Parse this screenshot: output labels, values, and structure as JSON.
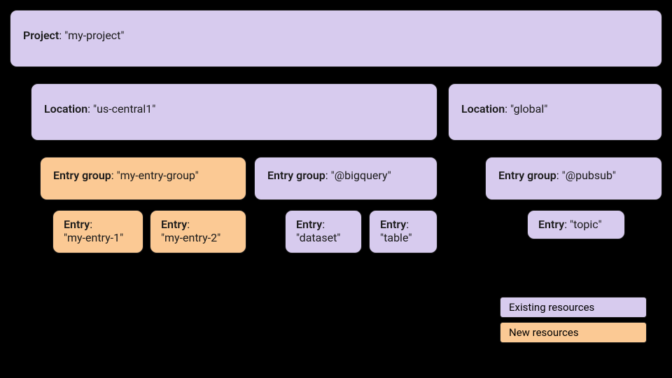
{
  "project": {
    "label": "Project",
    "value": "\"my-project\""
  },
  "locations": [
    {
      "label": "Location",
      "value": "\"us-central1\""
    },
    {
      "label": "Location",
      "value": "\"global\""
    }
  ],
  "entry_groups": [
    {
      "label": "Entry group",
      "value": "\"my-entry-group\"",
      "status": "new"
    },
    {
      "label": "Entry group",
      "value": "\"@bigquery\"",
      "status": "existing"
    },
    {
      "label": "Entry group",
      "value": "\"@pubsub\"",
      "status": "existing"
    }
  ],
  "entries": [
    {
      "label": "Entry",
      "value": "\"my-entry-1\"",
      "status": "new"
    },
    {
      "label": "Entry",
      "value": "\"my-entry-2\"",
      "status": "new"
    },
    {
      "label": "Entry",
      "value": "\"dataset\"",
      "status": "existing"
    },
    {
      "label": "Entry",
      "value": "\"table\"",
      "status": "existing"
    },
    {
      "label": "Entry",
      "value": "\"topic\"",
      "status": "existing"
    }
  ],
  "legend": {
    "existing": "Existing resources",
    "new": "New resources"
  }
}
